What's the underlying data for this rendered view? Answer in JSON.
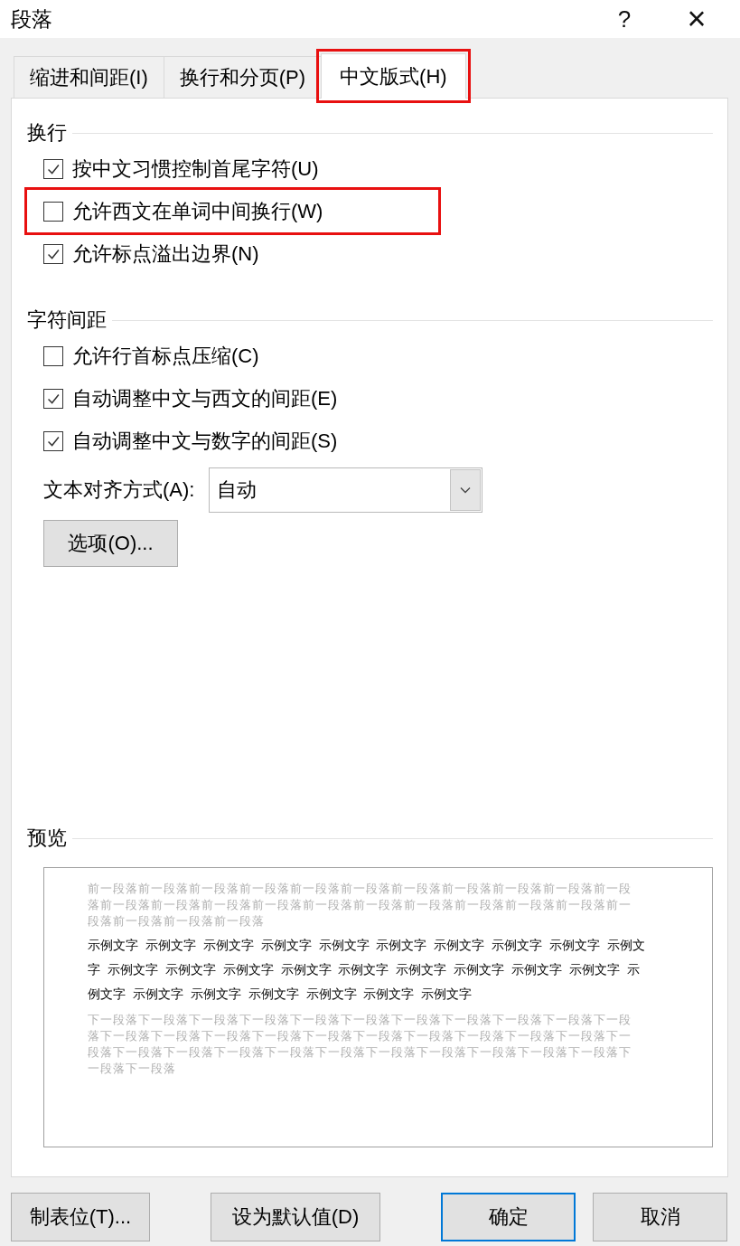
{
  "window": {
    "title": "段落",
    "help": "?",
    "close": "×"
  },
  "tabs": [
    {
      "label": "缩进和间距(I)",
      "selected": false,
      "highlighted": false
    },
    {
      "label": "换行和分页(P)",
      "selected": false,
      "highlighted": false
    },
    {
      "label": "中文版式(H)",
      "selected": true,
      "highlighted": true
    }
  ],
  "sections": [
    {
      "title": "换行",
      "checkboxes": [
        {
          "label": "按中文习惯控制首尾字符(U)",
          "checked": true,
          "highlighted": false
        },
        {
          "label": "允许西文在单词中间换行(W)",
          "checked": false,
          "highlighted": true
        },
        {
          "label": "允许标点溢出边界(N)",
          "checked": true,
          "highlighted": false
        }
      ]
    },
    {
      "title": "字符间距",
      "checkboxes": [
        {
          "label": "允许行首标点压缩(C)",
          "checked": false,
          "highlighted": false
        },
        {
          "label": "自动调整中文与西文的间距(E)",
          "checked": true,
          "highlighted": false
        },
        {
          "label": "自动调整中文与数字的间距(S)",
          "checked": true,
          "highlighted": false
        }
      ]
    }
  ],
  "alignment": {
    "label": "文本对齐方式(A):",
    "value": "自动"
  },
  "options_button": "选项(O)...",
  "preview": {
    "title": "预览",
    "previous": "前一段落前一段落前一段落前一段落前一段落前一段落前一段落前一段落前一段落前一段落前一段落前一段落前一段落前一段落前一段落前一段落前一段落前一段落前一段落前一段落前一段落前一段落前一段落前一段落前一段落",
    "sample": "示例文字 示例文字 示例文字 示例文字 示例文字 示例文字 示例文字 示例文字 示例文字 示例文字 示例文字 示例文字 示例文字 示例文字 示例文字 示例文字 示例文字 示例文字 示例文字 示例文字 示例文字 示例文字 示例文字 示例文字 示例文字 示例文字",
    "next": "下一段落下一段落下一段落下一段落下一段落下一段落下一段落下一段落下一段落下一段落下一段落下一段落下一段落下一段落下一段落下一段落下一段落下一段落下一段落下一段落下一段落下一段落下一段落下一段落下一段落下一段落下一段落下一段落下一段落下一段落下一段落下一段落下一段落下一段落"
  },
  "buttons": [
    {
      "label": "制表位(T)...",
      "default": false
    },
    {
      "label": "设为默认值(D)",
      "default": false
    },
    {
      "label": "确定",
      "default": true
    },
    {
      "label": "取消",
      "default": false
    }
  ]
}
